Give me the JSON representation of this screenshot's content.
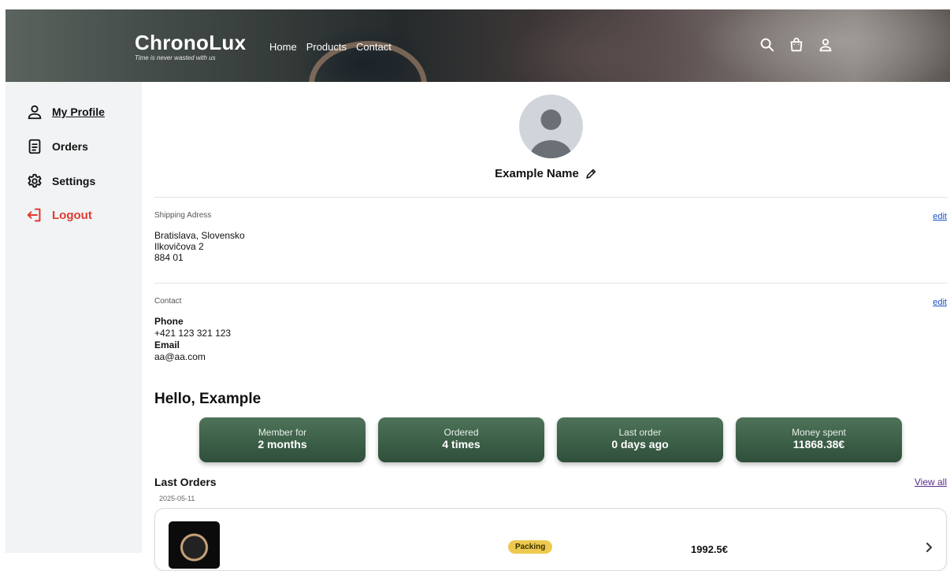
{
  "header": {
    "brand_title": "ChronoLux",
    "brand_tagline": "Time is never wasted with us",
    "nav": [
      "Home",
      "Products",
      "Contact"
    ],
    "icons": [
      "search-icon",
      "shopping-bag-icon",
      "user-icon"
    ]
  },
  "sidebar": {
    "items": [
      {
        "label": "My Profile",
        "icon": "user-icon",
        "active": true
      },
      {
        "label": "Orders",
        "icon": "document-icon"
      },
      {
        "label": "Settings",
        "icon": "gear-icon"
      },
      {
        "label": "Logout",
        "icon": "logout-icon",
        "color": "#e03a2e"
      }
    ]
  },
  "profile": {
    "name": "Example Name",
    "edit_icon": "pencil-icon"
  },
  "shipping": {
    "label": "Shipping Adress",
    "edit": "edit",
    "lines": [
      "Bratislava, Slovensko",
      "Ilkovičova 2",
      "884 01"
    ]
  },
  "contact": {
    "label": "Contact",
    "edit": "edit",
    "phone_label": "Phone",
    "phone": "+421 123 321 123",
    "email_label": "Email",
    "email": "aa@aa.com"
  },
  "greeting": "Hello, Example",
  "stats": [
    {
      "title": "Member for",
      "value": "2 months"
    },
    {
      "title": "Ordered",
      "value": "4 times"
    },
    {
      "title": "Last order",
      "value": "0 days ago"
    },
    {
      "title": "Money spent",
      "value": "11868.38€"
    }
  ],
  "last_orders": {
    "title": "Last Orders",
    "view_all": "View all",
    "orders": [
      {
        "date": "2025-05-11",
        "status": "Packing",
        "status_color": "#eec94f",
        "total": "1992.5€"
      }
    ]
  },
  "colors": {
    "accent_green": "#3c5f47",
    "logout_red": "#e03a2e",
    "sidebar_bg": "#f1f3f5"
  }
}
